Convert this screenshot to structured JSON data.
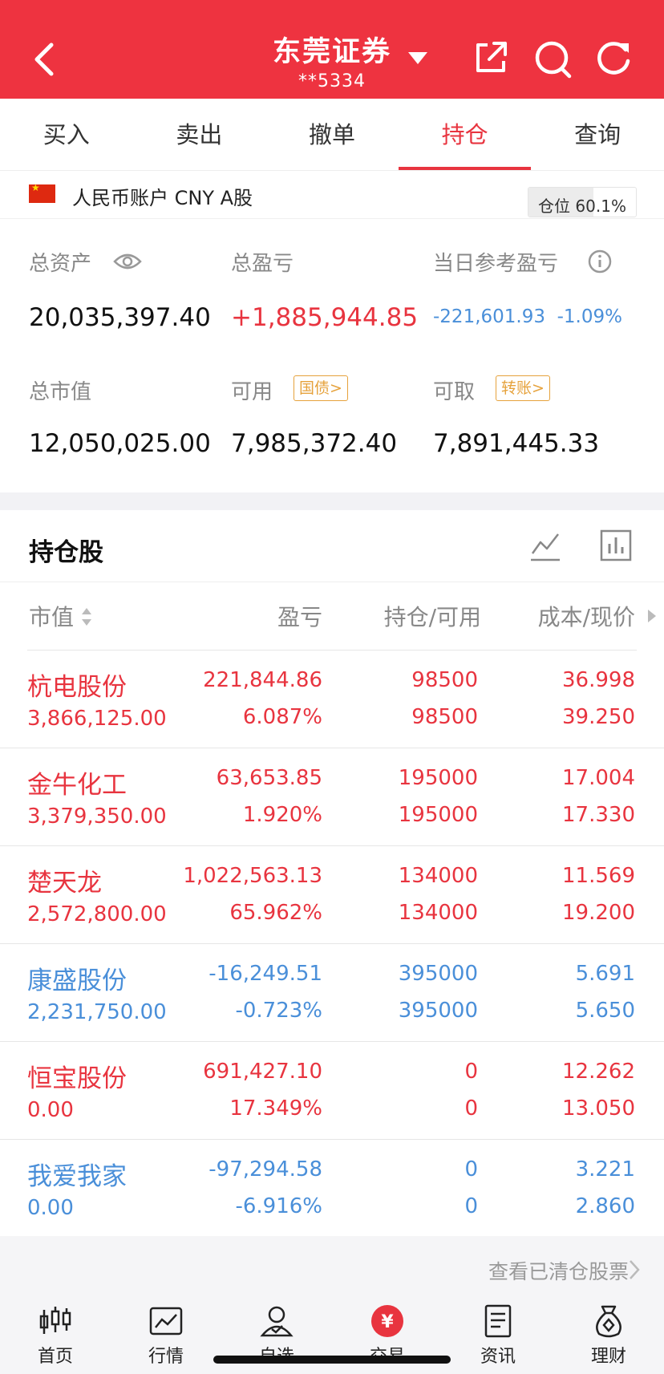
{
  "header": {
    "title": "东莞证券",
    "account": "**5334",
    "icons": [
      "back-icon",
      "dropdown-icon",
      "share-icon",
      "search-icon",
      "refresh-icon"
    ]
  },
  "tabs": [
    {
      "label": "买入",
      "active": false
    },
    {
      "label": "卖出",
      "active": false
    },
    {
      "label": "撤单",
      "active": false
    },
    {
      "label": "持仓",
      "active": true
    },
    {
      "label": "查询",
      "active": false
    }
  ],
  "account_row": {
    "label": "人民币账户 CNY A股",
    "position_label": "仓位",
    "position_value": "60.1%",
    "position_fraction": 0.601
  },
  "summary": {
    "total_assets_label": "总资产",
    "total_assets": "20,035,397.40",
    "total_pl_label": "总盈亏",
    "total_pl": "+1,885,944.85",
    "today_pl_label": "当日参考盈亏",
    "today_pl": "-221,601.93",
    "today_pl_pct": "-1.09%",
    "market_value_label": "总市值",
    "market_value": "12,050,025.00",
    "available_label": "可用",
    "available_tag": "国债>",
    "available": "7,985,372.40",
    "withdrawable_label": "可取",
    "withdrawable_tag": "转账>",
    "withdrawable": "7,891,445.33"
  },
  "holdings": {
    "title": "持仓股",
    "columns": [
      "市值",
      "盈亏",
      "持仓/可用",
      "成本/现价"
    ],
    "rows": [
      {
        "name": "杭电股份",
        "market_value": "3,866,125.00",
        "pl": "221,844.86",
        "pl_pct": "6.087%",
        "hold": "98500",
        "avail": "98500",
        "cost": "36.998",
        "price": "39.250",
        "color": "#e8343f"
      },
      {
        "name": "金牛化工",
        "market_value": "3,379,350.00",
        "pl": "63,653.85",
        "pl_pct": "1.920%",
        "hold": "195000",
        "avail": "195000",
        "cost": "17.004",
        "price": "17.330",
        "color": "#e8343f"
      },
      {
        "name": "楚天龙",
        "market_value": "2,572,800.00",
        "pl": "1,022,563.13",
        "pl_pct": "65.962%",
        "hold": "134000",
        "avail": "134000",
        "cost": "11.569",
        "price": "19.200",
        "color": "#e8343f"
      },
      {
        "name": "康盛股份",
        "market_value": "2,231,750.00",
        "pl": "-16,249.51",
        "pl_pct": "-0.723%",
        "hold": "395000",
        "avail": "395000",
        "cost": "5.691",
        "price": "5.650",
        "color": "#4a8fd9"
      },
      {
        "name": "恒宝股份",
        "market_value": "0.00",
        "pl": "691,427.10",
        "pl_pct": "17.349%",
        "hold": "0",
        "avail": "0",
        "cost": "12.262",
        "price": "13.050",
        "color": "#e8343f"
      },
      {
        "name": "我爱我家",
        "market_value": "0.00",
        "pl": "-97,294.58",
        "pl_pct": "-6.916%",
        "hold": "0",
        "avail": "0",
        "cost": "3.221",
        "price": "2.860",
        "color": "#4a8fd9"
      }
    ],
    "cleared_link": "查看已清仓股票"
  },
  "bottom_nav": [
    {
      "label": "首页",
      "icon": "candlestick-icon"
    },
    {
      "label": "行情",
      "icon": "market-chart-icon"
    },
    {
      "label": "自选",
      "icon": "person-check-icon"
    },
    {
      "label": "交易",
      "icon": "yuan-coin-icon"
    },
    {
      "label": "资讯",
      "icon": "document-icon"
    },
    {
      "label": "理财",
      "icon": "money-bag-icon"
    }
  ]
}
